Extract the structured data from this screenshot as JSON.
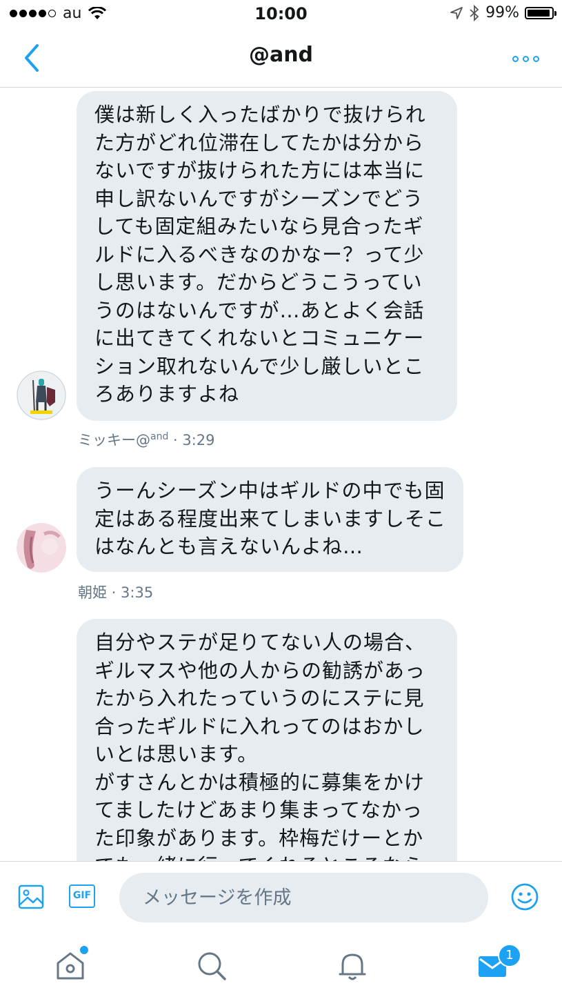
{
  "status_bar": {
    "carrier": "au",
    "time": "10:00",
    "battery": "99%"
  },
  "header": {
    "title": "@and",
    "back_icon": "chevron-left-icon",
    "more_icon": "more-dots-icon"
  },
  "messages": [
    {
      "text": "僕は新しく入ったばかりで抜けられた方がどれ位滞在してたかは分からないですが抜けられた方には本当に申し訳ないんですがシーズンでどうしても固定組みたいなら見合ったギルドに入るべきなのかなー？って少し思います。だからどうこうっていうのはないんですが…あとよく会話に出てきてくれないとコミュニケーション取れないんで少し厳しいところありますよね",
      "sender": "ミッキー@",
      "sender_sup": "and",
      "time": "3:29"
    },
    {
      "text": "うーんシーズン中はギルドの中でも固定はある程度出来てしまいますしそこはなんとも言えないんよね…",
      "sender": "朝姫",
      "time": "3:35"
    },
    {
      "text": "自分やステが足りてない人の場合、ギルマスや他の人からの勧誘があったから入れたっていうのにステに見合ったギルドに入れってのはおかしいとは思います。\nがすさんとかは積極的に募集をかけてましたけどあまり集まってなかった印象があります。枠梅だけーとかでも一緒に行ってくれるところなら"
    }
  ],
  "meta_separator": " · ",
  "composer": {
    "placeholder": "メッセージを作成",
    "gif_label": "GIF"
  },
  "tabbar": {
    "messages_badge": "1"
  },
  "colors": {
    "accent": "#1da1f2",
    "bubble": "#e6ecf0",
    "meta": "#657786"
  }
}
